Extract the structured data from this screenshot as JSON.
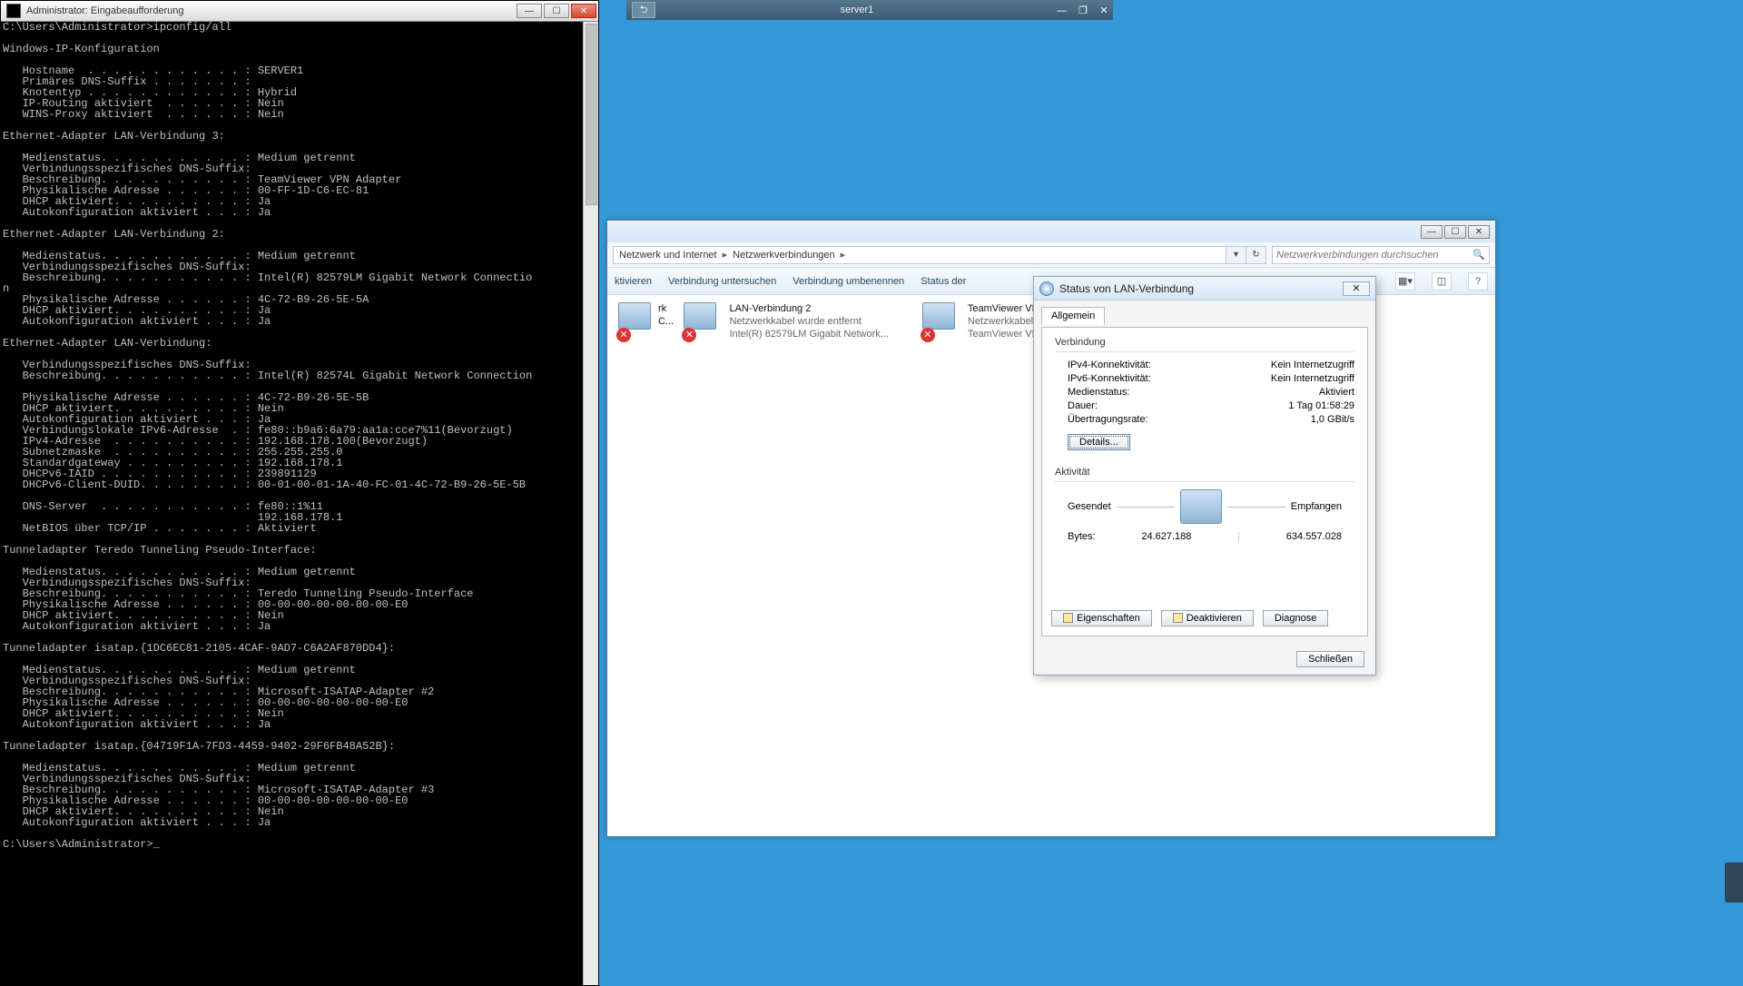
{
  "cmd": {
    "title": "Administrator: Eingabeaufforderung",
    "output": "C:\\Users\\Administrator>ipconfig/all\n\nWindows-IP-Konfiguration\n\n   Hostname  . . . . . . . . . . . . : SERVER1\n   Primäres DNS-Suffix . . . . . . . :\n   Knotentyp . . . . . . . . . . . . : Hybrid\n   IP-Routing aktiviert  . . . . . . : Nein\n   WINS-Proxy aktiviert  . . . . . . : Nein\n\nEthernet-Adapter LAN-Verbindung 3:\n\n   Medienstatus. . . . . . . . . . . : Medium getrennt\n   Verbindungsspezifisches DNS-Suffix:\n   Beschreibung. . . . . . . . . . . : TeamViewer VPN Adapter\n   Physikalische Adresse . . . . . . : 00-FF-1D-C6-EC-81\n   DHCP aktiviert. . . . . . . . . . : Ja\n   Autokonfiguration aktiviert . . . : Ja\n\nEthernet-Adapter LAN-Verbindung 2:\n\n   Medienstatus. . . . . . . . . . . : Medium getrennt\n   Verbindungsspezifisches DNS-Suffix:\n   Beschreibung. . . . . . . . . . . : Intel(R) 82579LM Gigabit Network Connectio\nn\n   Physikalische Adresse . . . . . . : 4C-72-B9-26-5E-5A\n   DHCP aktiviert. . . . . . . . . . : Ja\n   Autokonfiguration aktiviert . . . : Ja\n\nEthernet-Adapter LAN-Verbindung:\n\n   Verbindungsspezifisches DNS-Suffix:\n   Beschreibung. . . . . . . . . . . : Intel(R) 82574L Gigabit Network Connection\n\n   Physikalische Adresse . . . . . . : 4C-72-B9-26-5E-5B\n   DHCP aktiviert. . . . . . . . . . : Nein\n   Autokonfiguration aktiviert . . . : Ja\n   Verbindungslokale IPv6-Adresse  . : fe80::b9a6:6a79:aa1a:cce7%11(Bevorzugt)\n   IPv4-Adresse  . . . . . . . . . . : 192.168.178.100(Bevorzugt)\n   Subnetzmaske  . . . . . . . . . . : 255.255.255.0\n   Standardgateway . . . . . . . . . : 192.168.178.1\n   DHCPv6-IAID . . . . . . . . . . . : 239891129\n   DHCPv6-Client-DUID. . . . . . . . : 00-01-00-01-1A-40-FC-01-4C-72-B9-26-5E-5B\n\n   DNS-Server  . . . . . . . . . . . : fe80::1%11\n                                       192.168.178.1\n   NetBIOS über TCP/IP . . . . . . . : Aktiviert\n\nTunneladapter Teredo Tunneling Pseudo-Interface:\n\n   Medienstatus. . . . . . . . . . . : Medium getrennt\n   Verbindungsspezifisches DNS-Suffix:\n   Beschreibung. . . . . . . . . . . : Teredo Tunneling Pseudo-Interface\n   Physikalische Adresse . . . . . . : 00-00-00-00-00-00-00-E0\n   DHCP aktiviert. . . . . . . . . . : Nein\n   Autokonfiguration aktiviert . . . : Ja\n\nTunneladapter isatap.{1DC6EC81-2105-4CAF-9AD7-C6A2AF870DD4}:\n\n   Medienstatus. . . . . . . . . . . : Medium getrennt\n   Verbindungsspezifisches DNS-Suffix:\n   Beschreibung. . . . . . . . . . . : Microsoft-ISATAP-Adapter #2\n   Physikalische Adresse . . . . . . : 00-00-00-00-00-00-00-E0\n   DHCP aktiviert. . . . . . . . . . : Nein\n   Autokonfiguration aktiviert . . . : Ja\n\nTunneladapter isatap.{04719F1A-7FD3-4459-9402-29F6FB48A52B}:\n\n   Medienstatus. . . . . . . . . . . : Medium getrennt\n   Verbindungsspezifisches DNS-Suffix:\n   Beschreibung. . . . . . . . . . . : Microsoft-ISATAP-Adapter #3\n   Physikalische Adresse . . . . . . : 00-00-00-00-00-00-00-E0\n   DHCP aktiviert. . . . . . . . . . : Nein\n   Autokonfiguration aktiviert . . . : Ja\n\nC:\\Users\\Administrator>_"
  },
  "topbar": {
    "label": "server1"
  },
  "explorer": {
    "crumb1": "Netzwerk und Internet",
    "crumb2": "Netzwerkverbindungen",
    "search_placeholder": "Netzwerkverbindungen durchsuchen",
    "cmds": {
      "c1": "ktivieren",
      "c2": "Verbindung untersuchen",
      "c3": "Verbindung umbenennen",
      "c4": "Status der"
    },
    "items": [
      {
        "name": "rk C...",
        "sub1": "",
        "sub2": ""
      },
      {
        "name": "LAN-Verbindung 2",
        "sub1": "Netzwerkkabel wurde entfernt",
        "sub2": "Intel(R) 82579LM Gigabit Network..."
      },
      {
        "name": "TeamViewer VPN",
        "sub1": "Netzwerkkabel wurd",
        "sub2": "TeamViewer VPN Ad"
      }
    ]
  },
  "status": {
    "title": "Status von LAN-Verbindung",
    "tab": "Allgemein",
    "grp_conn": "Verbindung",
    "ipv4_l": "IPv4-Konnektivität:",
    "ipv4_v": "Kein Internetzugriff",
    "ipv6_l": "IPv6-Konnektivität:",
    "ipv6_v": "Kein Internetzugriff",
    "med_l": "Medienstatus:",
    "med_v": "Aktiviert",
    "dur_l": "Dauer:",
    "dur_v": "1 Tag 01:58:29",
    "rate_l": "Übertragungsrate:",
    "rate_v": "1,0 GBit/s",
    "details": "Details...",
    "grp_act": "Aktivität",
    "sent": "Gesendet",
    "recv": "Empfangen",
    "bytes_l": "Bytes:",
    "bytes_sent": "24.627.188",
    "bytes_recv": "634.557.028",
    "btn_props": "Eigenschaften",
    "btn_disable": "Deaktivieren",
    "btn_diag": "Diagnose",
    "btn_close": "Schließen"
  }
}
